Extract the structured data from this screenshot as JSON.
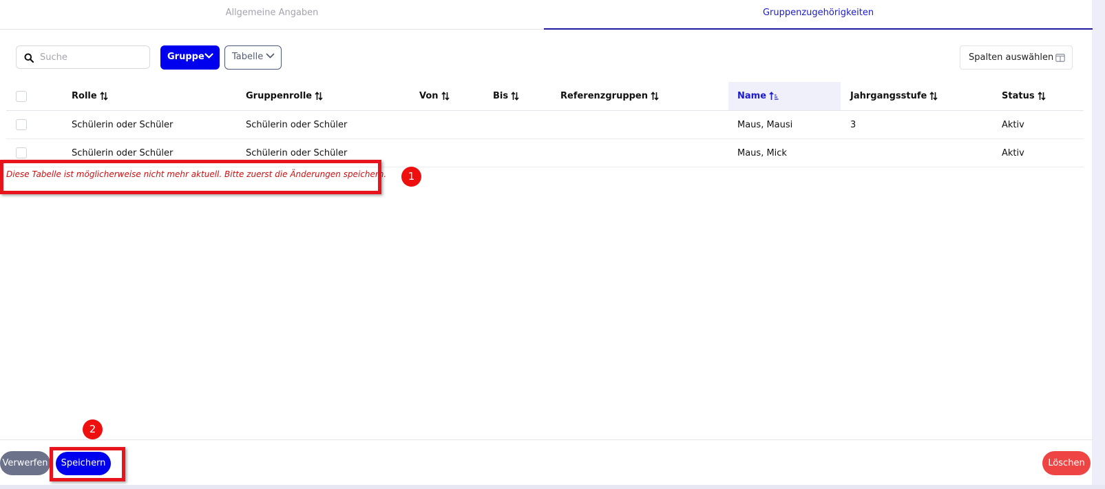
{
  "tabs": [
    {
      "label": "Allgemeine Angaben",
      "active": false
    },
    {
      "label": "Gruppenzugehörigkeiten",
      "active": true
    }
  ],
  "toolbar": {
    "search_placeholder": "Suche",
    "group_button": "Gruppe",
    "table_button": "Tabelle",
    "columns_button": "Spalten auswählen"
  },
  "table": {
    "columns": [
      "Rolle",
      "Gruppenrolle",
      "Von",
      "Bis",
      "Referenzgruppen",
      "Name",
      "Jahrgangsstufe",
      "Status"
    ],
    "sorted_column": "Name",
    "rows": [
      {
        "rolle": "Schülerin oder Schüler",
        "gruppenrolle": "Schülerin oder Schüler",
        "von": "",
        "bis": "",
        "referenzgruppen": "",
        "name": "Maus, Mausi",
        "jahrgangsstufe": "3",
        "status": "Aktiv"
      },
      {
        "rolle": "Schülerin oder Schüler",
        "gruppenrolle": "Schülerin oder Schüler",
        "von": "",
        "bis": "",
        "referenzgruppen": "",
        "name": "Maus, Mick",
        "jahrgangsstufe": "",
        "status": "Aktiv"
      }
    ]
  },
  "warning": "Diese Tabelle ist möglicherweise nicht mehr aktuell. Bitte zuerst die Änderungen speichern.",
  "annotations": {
    "marker1": "1",
    "marker2": "2"
  },
  "footer": {
    "discard": "Verwerfen",
    "save": "Speichern",
    "delete": "Löschen"
  },
  "colors": {
    "primary": "#0000ee",
    "warning_text": "#cc1111",
    "annotation_red": "#e8141c",
    "delete": "#ef4444",
    "discard": "#6b7289"
  }
}
